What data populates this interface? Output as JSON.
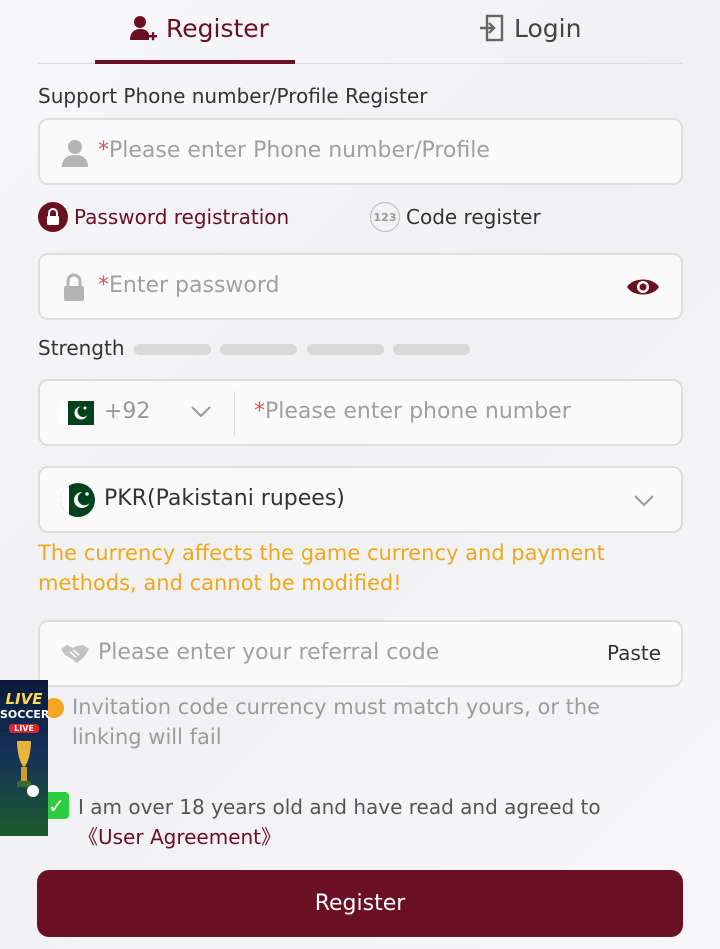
{
  "tabs": {
    "register": "Register",
    "login": "Login"
  },
  "register_title": "Support Phone number/Profile Register",
  "profile_field": {
    "required": "*",
    "placeholder": "Please enter Phone number/Profile"
  },
  "modes": {
    "password": "Password registration",
    "code": "Code register",
    "code_icon": "123"
  },
  "password_field": {
    "required": "*",
    "placeholder": "Enter password"
  },
  "strength_label": "Strength",
  "phone_field": {
    "country_code": "+92",
    "required": "*",
    "placeholder": "Please enter phone number"
  },
  "currency_field": {
    "value": "PKR(Pakistani rupees)"
  },
  "currency_notice": "The currency affects the game currency and payment methods,  and cannot be modified!",
  "referral_field": {
    "placeholder": "Please enter your referral code",
    "paste": "Paste"
  },
  "referral_warning": "Invitation code currency must match yours,  or the linking will fail",
  "agreement": {
    "text": "I am over 18 years old and have read and agreed to ",
    "link": "《User Agreement》"
  },
  "register_button": "Register",
  "ad": {
    "line1": "LIVE",
    "line2": "SOCCER",
    "badge": "LIVE"
  },
  "colors": {
    "primary": "#6b0f22",
    "notice": "#f0a81a",
    "check": "#2ecc40",
    "flag_green": "#01411c"
  },
  "icons": [
    "user-plus-icon",
    "login-icon",
    "user-icon",
    "lock-icon",
    "eye-icon",
    "chevron-down-icon",
    "handshake-icon",
    "warning-icon",
    "check-icon"
  ]
}
